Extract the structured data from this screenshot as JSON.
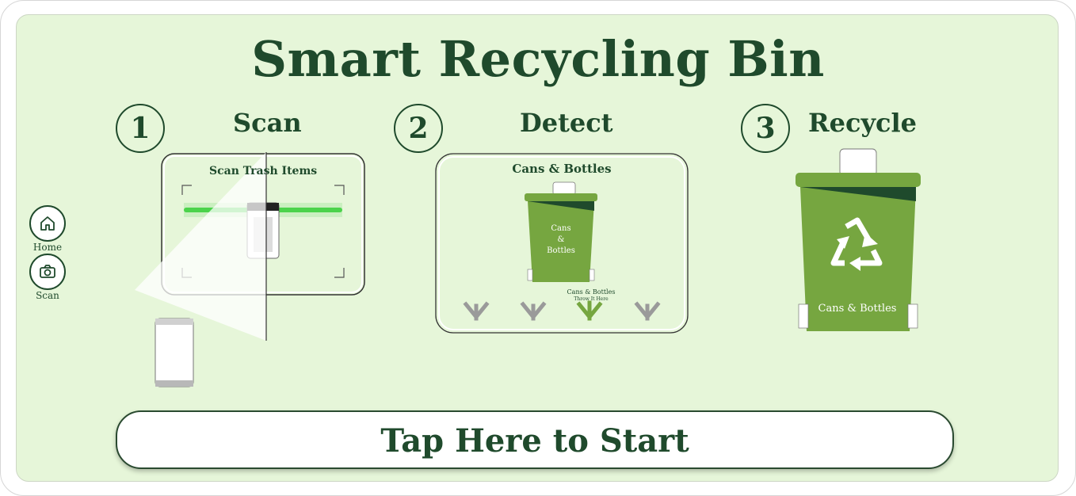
{
  "app": {
    "title": "Smart Recycling Bin"
  },
  "nav": [
    {
      "label": "Home",
      "icon": "home-icon"
    },
    {
      "label": "Scan",
      "icon": "camera-icon"
    }
  ],
  "steps": [
    {
      "number": "1",
      "label": "Scan",
      "screen_title": "Scan Trash Items"
    },
    {
      "number": "2",
      "label": "Detect",
      "screen_title": "Cans & Bottles",
      "bin_text_1": "Cans",
      "bin_text_2": "&",
      "bin_text_3": "Bottles",
      "hint_1": "Cans & Bottles",
      "hint_2": "Throw It Here"
    },
    {
      "number": "3",
      "label": "Recycle",
      "bin_label": "Cans & Bottles"
    }
  ],
  "start_button": {
    "label": "Tap Here to Start"
  },
  "colors": {
    "brand": "#1f4a2c",
    "bin": "#76a640",
    "background": "#e6f6d9",
    "arrow_active": "#76a640",
    "arrow_inactive": "#9a9a9a",
    "scanner": "#4bd44b"
  }
}
